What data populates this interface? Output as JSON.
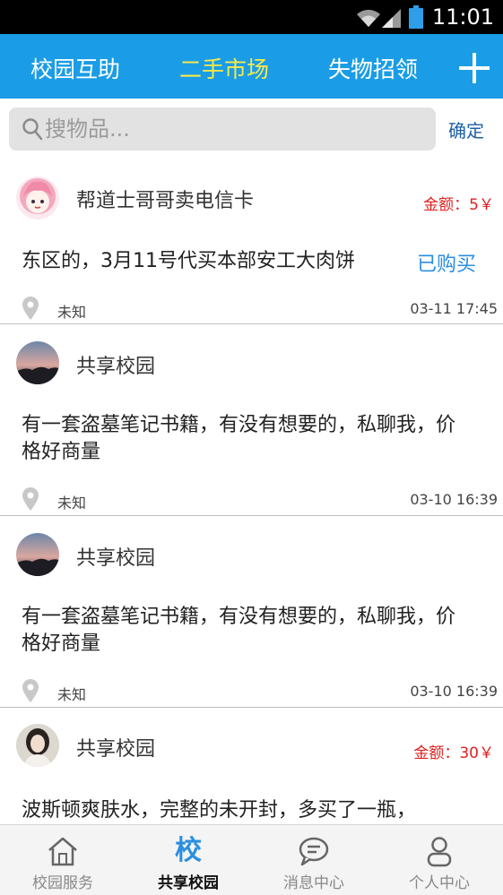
{
  "status_bar": {
    "time": "11:01"
  },
  "top_nav": {
    "tabs": [
      {
        "label": "校园互助",
        "active": false
      },
      {
        "label": "二手市场",
        "active": true
      },
      {
        "label": "失物招领",
        "active": false
      }
    ],
    "add_icon": "plus-icon"
  },
  "search": {
    "placeholder": "搜物品...",
    "confirm_label": "确定"
  },
  "posts": [
    {
      "author": "帮道士哥哥卖电信卡",
      "price": "金额：5￥",
      "content": "东区的，3月11号代买本部安工大肉饼",
      "status": "已购买",
      "location": "未知",
      "time": "03-11 17:45"
    },
    {
      "author": "共享校园",
      "content": "有一套盗墓笔记书籍，有没有想要的，私聊我，价格好商量",
      "location": "未知",
      "time": "03-10 16:39"
    },
    {
      "author": "共享校园",
      "content": "有一套盗墓笔记书籍，有没有想要的，私聊我，价格好商量",
      "location": "未知",
      "time": "03-10 16:39"
    },
    {
      "author": "共享校园",
      "price": "金额：30￥",
      "content": "波斯顿爽肤水，完整的未开封，多买了一瓶，"
    }
  ],
  "bottom_nav": {
    "items": [
      {
        "label": "校园服务",
        "icon": "home-icon"
      },
      {
        "label": "共享校园",
        "icon": "school-icon",
        "glyph": "校",
        "active": true
      },
      {
        "label": "消息中心",
        "icon": "message-icon"
      },
      {
        "label": "个人中心",
        "icon": "user-icon"
      }
    ]
  },
  "colors": {
    "primary": "#1a9de6",
    "active_tab": "#f6e94a",
    "price": "#e02020",
    "bought": "#2a8de0"
  }
}
